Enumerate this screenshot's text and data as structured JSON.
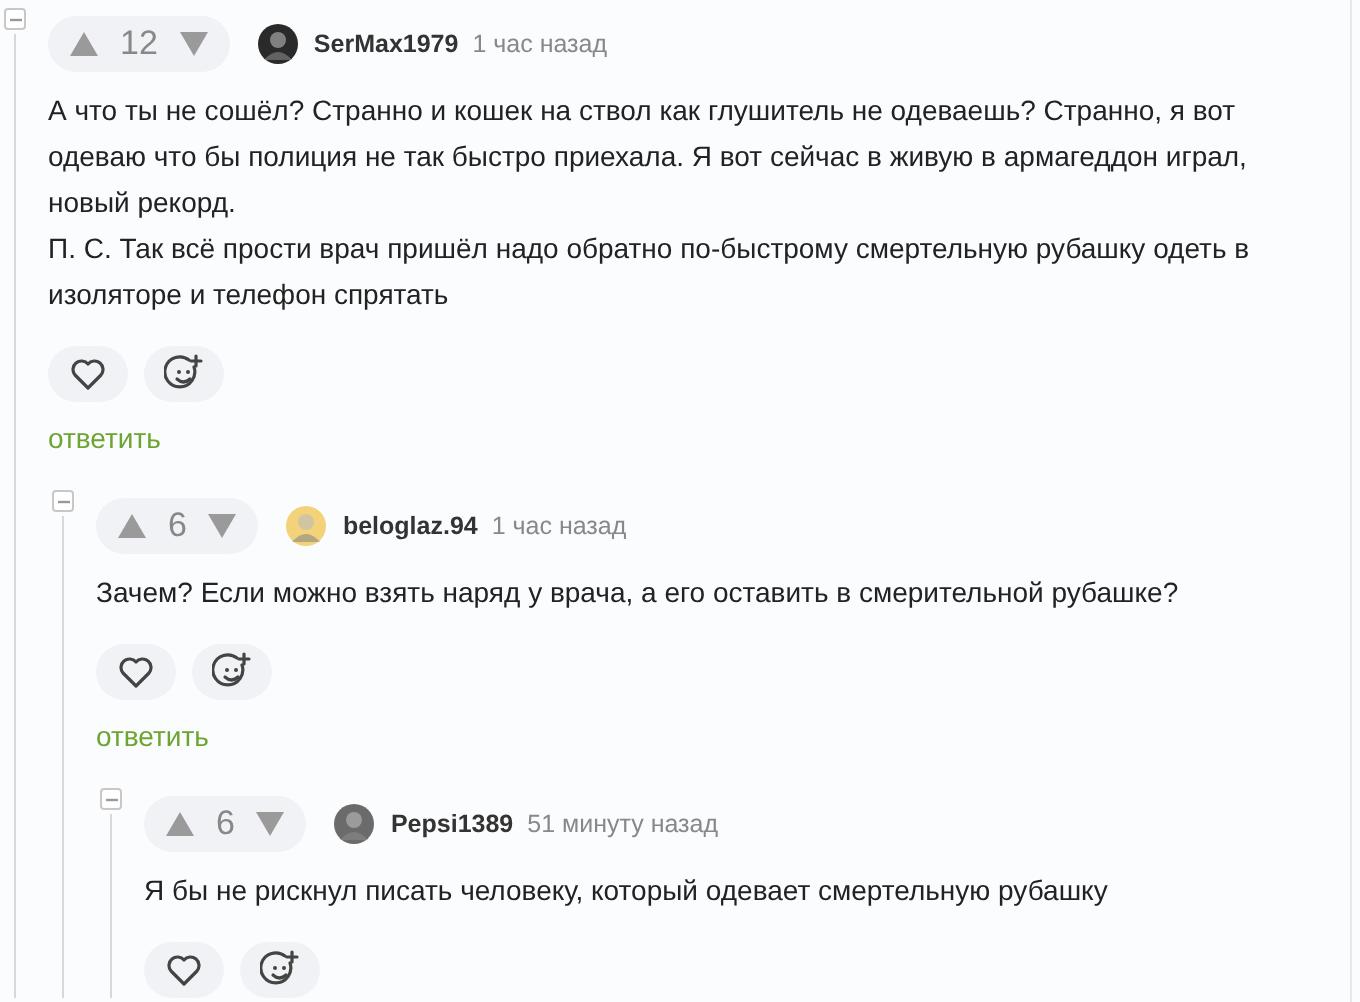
{
  "comments": [
    {
      "votes": "12",
      "author": "SerMax1979",
      "time": "1 час назад",
      "paragraphs": [
        "А что ты не сошёл? Странно и кошек на ствол как глушитель не одеваешь? Странно, я вот одеваю что бы полиция не так быстро приехала. Я вот сейчас в живую в армагеддон играл, новый рекорд.",
        "П. С. Так всё прости врач пришёл надо обратно по-быстрому смертельную рубашку одеть в изоляторе и телефон спрятать"
      ],
      "reply": "ответить",
      "expanded": true,
      "children": [
        {
          "votes": "6",
          "author": "beloglaz.94",
          "time": "1 час назад",
          "paragraphs": [
            "Зачем? Если можно взять наряд у врача, а его оставить в смерительной рубашке?"
          ],
          "reply": "ответить",
          "expanded": true,
          "children": [
            {
              "votes": "6",
              "author": "Pepsi1389",
              "time": "51 минуту назад",
              "paragraphs": [
                "Я бы не рискнул писать человеку, который одевает смертельную рубашку"
              ],
              "expanded": true
            }
          ]
        }
      ]
    }
  ]
}
